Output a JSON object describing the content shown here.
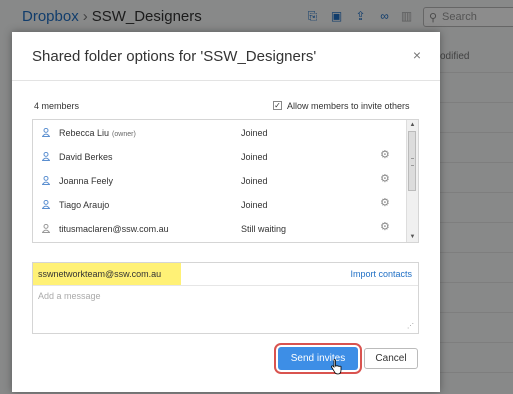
{
  "background": {
    "breadcrumb_root": "Dropbox",
    "breadcrumb_separator": "›",
    "breadcrumb_folder": "SSW_Designers",
    "search_placeholder": "Search",
    "column_modified": "odified",
    "toolbar_icons": [
      "share-icon",
      "new-folder-icon",
      "upload-icon",
      "link-icon",
      "delete-icon"
    ]
  },
  "modal": {
    "title": "Shared folder options for 'SSW_Designers'",
    "close_label": "×",
    "member_count": "4 members",
    "allow_invite_label": "Allow members to invite others",
    "allow_invite_checked": true,
    "members": [
      {
        "name": "Rebecca Liu",
        "role": "(owner)",
        "status": "Joined",
        "has_gear": false
      },
      {
        "name": "David Berkes",
        "role": "",
        "status": "Joined",
        "has_gear": true
      },
      {
        "name": "Joanna Feely",
        "role": "",
        "status": "Joined",
        "has_gear": true
      },
      {
        "name": "Tiago Araujo",
        "role": "",
        "status": "Joined",
        "has_gear": true
      },
      {
        "name": "titusmaclaren@ssw.com.au",
        "role": "",
        "status": "Still waiting",
        "has_gear": true
      }
    ],
    "invite_email": "sswnetworkteam@ssw.com.au",
    "import_contacts": "Import contacts",
    "message_placeholder": "Add a message",
    "send_label": "Send invites",
    "cancel_label": "Cancel"
  },
  "colors": {
    "accent": "#1f6fc5",
    "send_button": "#3d8ee6",
    "highlight": "#fff176",
    "focus_outline": "#d9534f"
  }
}
